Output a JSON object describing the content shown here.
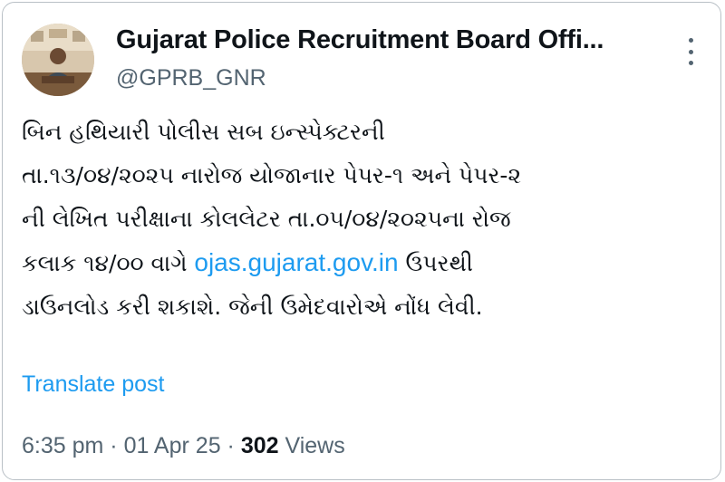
{
  "author": {
    "display_name": "Gujarat Police Recruitment Board Offi...",
    "handle": "@GPRB_GNR"
  },
  "tweet": {
    "line1": "બિન હથિયારી પોલીસ સબ ઇન્સ્પેક્ટરની",
    "line2": "તા.૧૩/૦૪/૨૦૨૫ નારોજ યોજાનાર પેપર-૧ અને પેપર-૨",
    "line3": "ની લેખિત પરીક્ષાના કોલલેટર તા.૦૫/૦૪/૨૦૨૫ના રોજ",
    "line4_before": "કલાક ૧૪/૦૦ વાગે ",
    "link": "ojas.gujarat.gov.in",
    "line4_after": " ઉપરથી",
    "line5": "ડાઉનલોડ કરી શકાશે. જેની ઉમેદવારોએ નોંધ લેવી."
  },
  "translate_label": "Translate post",
  "meta": {
    "time": "6:35 pm",
    "separator": " · ",
    "date": "01 Apr 25",
    "views_count": "302",
    "views_label": "Views"
  },
  "icons": {
    "more": "more-options-icon",
    "avatar": "profile-avatar"
  },
  "colors": {
    "link": "#1d9bf0",
    "secondary_text": "#536471",
    "primary_text": "#0f1419"
  }
}
